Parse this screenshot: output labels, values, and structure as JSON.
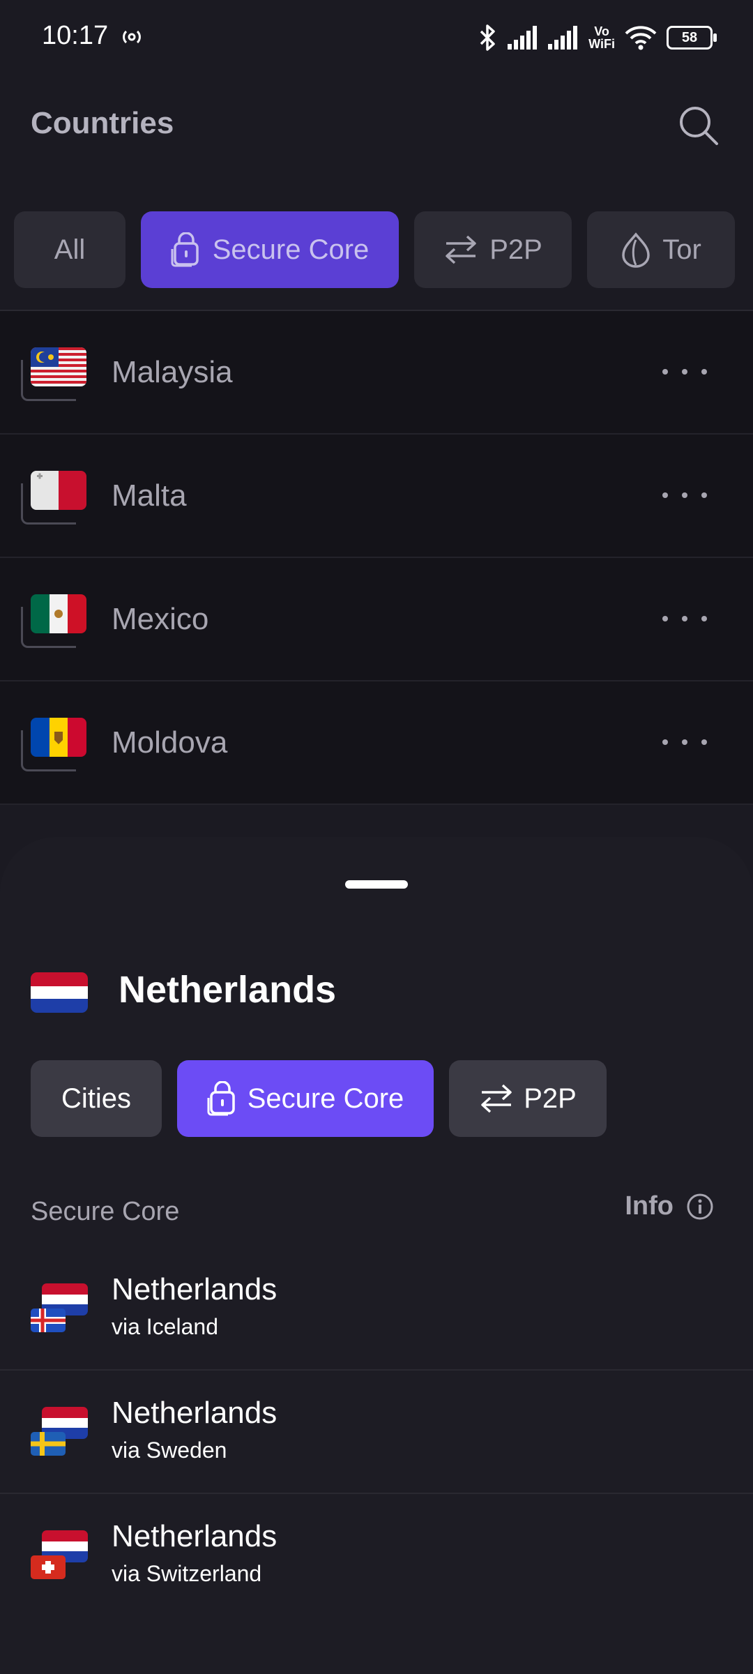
{
  "status_bar": {
    "time": "10:17",
    "battery": "58",
    "vowifi_top": "Vo",
    "vowifi_bottom": "WiFi"
  },
  "header": {
    "title": "Countries"
  },
  "filters": [
    {
      "label": "All",
      "active": false
    },
    {
      "label": "Secure Core",
      "active": true
    },
    {
      "label": "P2P",
      "active": false
    },
    {
      "label": "Tor",
      "active": false
    }
  ],
  "countries": [
    {
      "name": "Malaysia"
    },
    {
      "name": "Malta"
    },
    {
      "name": "Mexico"
    },
    {
      "name": "Moldova"
    }
  ],
  "sheet": {
    "country": "Netherlands",
    "tabs": [
      {
        "label": "Cities",
        "active": false
      },
      {
        "label": "Secure Core",
        "active": true
      },
      {
        "label": "P2P",
        "active": false
      }
    ],
    "section_label": "Secure Core",
    "info_label": "Info",
    "servers": [
      {
        "name": "Netherlands",
        "via": "via Iceland"
      },
      {
        "name": "Netherlands",
        "via": "via Sweden"
      },
      {
        "name": "Netherlands",
        "via": "via Switzerland"
      }
    ]
  },
  "colors": {
    "accent": "#6c4cf5",
    "accent_dim": "#5b3fd4",
    "background": "#1b1a22",
    "list_bg": "#141319"
  }
}
